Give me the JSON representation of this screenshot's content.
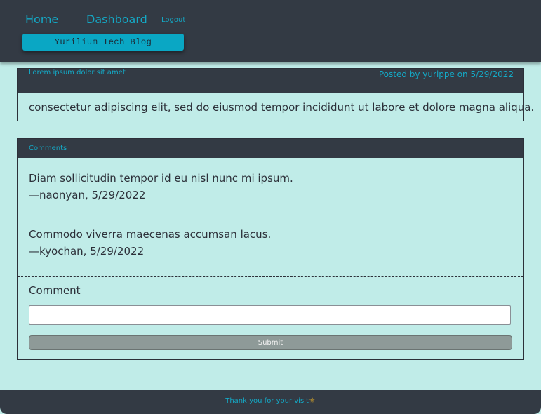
{
  "nav": {
    "home": "Home",
    "dashboard": "Dashboard",
    "logout": "Logout"
  },
  "brand": "Yurilium Tech Blog",
  "post": {
    "title": "Lorem ipsum dolor sit amet",
    "meta": "Posted by yurippe on 5/29/2022",
    "body": "consectetur adipiscing elit, sed do eiusmod tempor incididunt ut labore et dolore magna aliqua."
  },
  "comments": {
    "title": "Comments",
    "items": [
      {
        "text": "Diam sollicitudin tempor id eu nisl nunc mi ipsum.",
        "byline": "—naonyan, 5/29/2022"
      },
      {
        "text": "Commodo viverra maecenas accumsan lacus.",
        "byline": "—kyochan, 5/29/2022"
      }
    ],
    "form": {
      "label": "Comment",
      "input_value": "",
      "submit_label": "Submit"
    }
  },
  "footer": {
    "text": "Thank you for your visit",
    "icon": "fleur-de-lis-icon",
    "icon_glyph": "⚜"
  },
  "colors": {
    "background": "#c0ece8",
    "header": "#333a44",
    "accent": "#14a9c6",
    "brand": "#0aa7c4",
    "submit": "#8e9a98"
  }
}
